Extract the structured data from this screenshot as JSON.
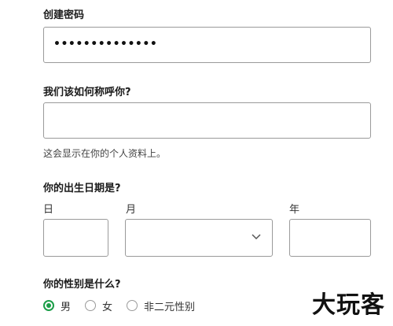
{
  "password": {
    "label": "创建密码",
    "value_masked": "••••••••••••••"
  },
  "name": {
    "label": "我们该如何称呼你?",
    "value": "",
    "hint": "这会显示在你的个人资料上。"
  },
  "birthdate": {
    "label": "你的出生日期是?",
    "day_label": "日",
    "month_label": "月",
    "year_label": "年",
    "day_value": "",
    "month_value": "",
    "year_value": ""
  },
  "gender": {
    "label": "你的性别是什么?",
    "options": [
      {
        "label": "男",
        "selected": true
      },
      {
        "label": "女",
        "selected": false
      },
      {
        "label": "非二元性别",
        "selected": false
      }
    ]
  },
  "colors": {
    "accent": "#1b9e48",
    "border": "#9a9a9a"
  },
  "watermark": "大玩客"
}
